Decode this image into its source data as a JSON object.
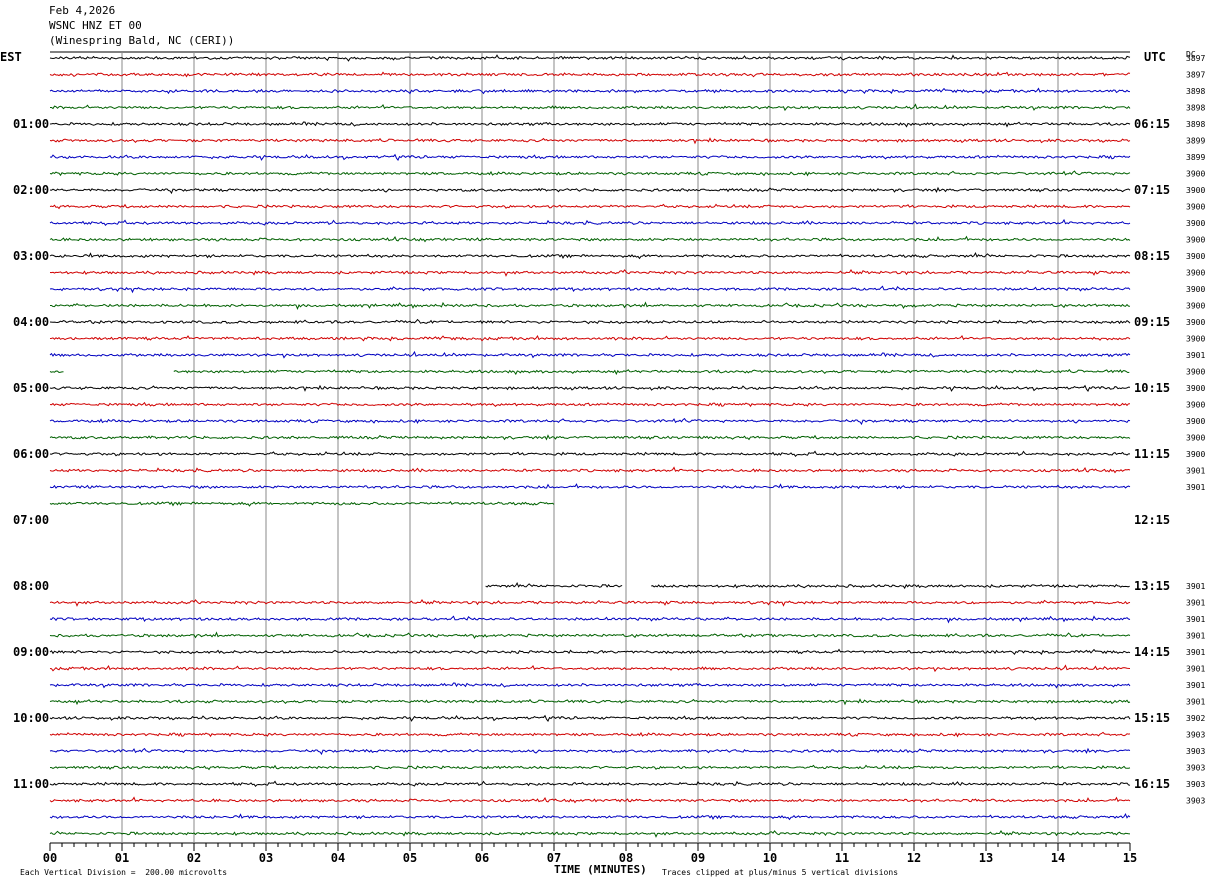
{
  "header": {
    "date": "Feb 4,2026",
    "station": "WSNC HNZ ET 00",
    "location": "(Winespring Bald, NC (CERI))"
  },
  "axis": {
    "left_zone": "EST",
    "right_zone": "UTC",
    "dc_label": "DC",
    "xlabel": "TIME (MINUTES)"
  },
  "footer": {
    "scale_note": "Each Vertical Division =  200.00 microvolts",
    "clip_note": "Traces clipped at plus/minus 5 vertical divisions"
  },
  "chart_data": {
    "type": "line",
    "title": "WSNC HNZ ET 00",
    "xlabel": "TIME (MINUTES)",
    "xlim": [
      0,
      15
    ],
    "x_ticks": [
      "00",
      "01",
      "02",
      "03",
      "04",
      "05",
      "06",
      "07",
      "08",
      "09",
      "10",
      "11",
      "12",
      "13",
      "14",
      "15"
    ],
    "left_hour_labels": [
      "01:00",
      "02:00",
      "03:00",
      "04:00",
      "05:00",
      "06:00",
      "07:00",
      "08:00",
      "09:00",
      "10:00",
      "11:00"
    ],
    "right_hour_labels": [
      "06:15",
      "07:15",
      "08:15",
      "09:15",
      "10:15",
      "11:15",
      "12:15",
      "13:15",
      "14:15",
      "15:15",
      "16:15"
    ],
    "trace_colors": [
      "#000000",
      "#d00000",
      "#0000c0",
      "#006000"
    ],
    "dc_offsets": [
      "3897",
      "3897",
      "3898",
      "3898",
      "3898",
      "3899",
      "3899",
      "3900",
      "3900",
      "3900",
      "3900",
      "3900",
      "3900",
      "3900",
      "3900",
      "3900",
      "3900",
      "3900",
      "3901",
      "3900",
      "3900",
      "3900",
      "3900",
      "3900",
      "3900",
      "3901",
      "3901",
      "",
      "",
      "",
      "",
      "",
      "3901",
      "3901",
      "3901",
      "3901",
      "3901",
      "3901",
      "3901",
      "3901",
      "3902",
      "3903",
      "3903",
      "3903",
      "3903",
      "3903"
    ],
    "trace_segments": [
      [
        [
          0,
          15
        ]
      ],
      [
        [
          0,
          15
        ]
      ],
      [
        [
          0,
          15
        ]
      ],
      [
        [
          0,
          15
        ]
      ],
      [
        [
          0,
          15
        ]
      ],
      [
        [
          0,
          15
        ]
      ],
      [
        [
          0,
          15
        ]
      ],
      [
        [
          0,
          15
        ]
      ],
      [
        [
          0,
          15
        ]
      ],
      [
        [
          0,
          15
        ]
      ],
      [
        [
          0,
          15
        ]
      ],
      [
        [
          0,
          15
        ]
      ],
      [
        [
          0,
          15
        ]
      ],
      [
        [
          0,
          15
        ]
      ],
      [
        [
          0,
          15
        ]
      ],
      [
        [
          0,
          15
        ]
      ],
      [
        [
          0,
          15
        ]
      ],
      [
        [
          0,
          15
        ]
      ],
      [
        [
          0,
          15
        ]
      ],
      [
        [
          0,
          0.2
        ],
        [
          1.72,
          15
        ]
      ],
      [
        [
          0,
          15
        ]
      ],
      [
        [
          0,
          15
        ]
      ],
      [
        [
          0,
          15
        ]
      ],
      [
        [
          0,
          15
        ]
      ],
      [
        [
          0,
          15
        ]
      ],
      [
        [
          0,
          15
        ]
      ],
      [
        [
          0,
          15
        ]
      ],
      [
        [
          0,
          7
        ]
      ],
      [],
      [],
      [],
      [],
      [
        [
          6.05,
          7.95
        ],
        [
          8.35,
          15
        ]
      ],
      [
        [
          0,
          15
        ]
      ],
      [
        [
          0,
          15
        ]
      ],
      [
        [
          0,
          15
        ]
      ],
      [
        [
          0,
          15
        ]
      ],
      [
        [
          0,
          15
        ]
      ],
      [
        [
          0,
          15
        ]
      ],
      [
        [
          0,
          15
        ]
      ],
      [
        [
          0,
          15
        ]
      ],
      [
        [
          0,
          15
        ]
      ],
      [
        [
          0,
          15
        ]
      ],
      [
        [
          0,
          15
        ]
      ],
      [
        [
          0,
          15
        ]
      ],
      [
        [
          0,
          15
        ]
      ],
      [
        [
          0,
          15
        ]
      ],
      [
        [
          0,
          15
        ]
      ]
    ]
  }
}
